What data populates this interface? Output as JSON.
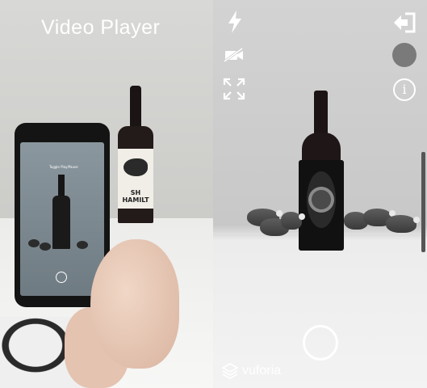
{
  "left_panel": {
    "title": "Video Player",
    "phone_hint": "Toggle Play/Pause",
    "bottle_label": "SH HAMILT"
  },
  "ar_view": {
    "icons": {
      "flash": "flash-icon",
      "video_toggle": "video-off-icon",
      "fullscreen": "expand-icon",
      "exit": "exit-icon",
      "record": "record-dot-icon",
      "info": "info-icon",
      "capture": "capture-button"
    },
    "info_glyph": "i",
    "brand_name": "vuforia",
    "colors": {
      "icon": "#ffffff",
      "record_dot": "#7a7a7a"
    }
  }
}
